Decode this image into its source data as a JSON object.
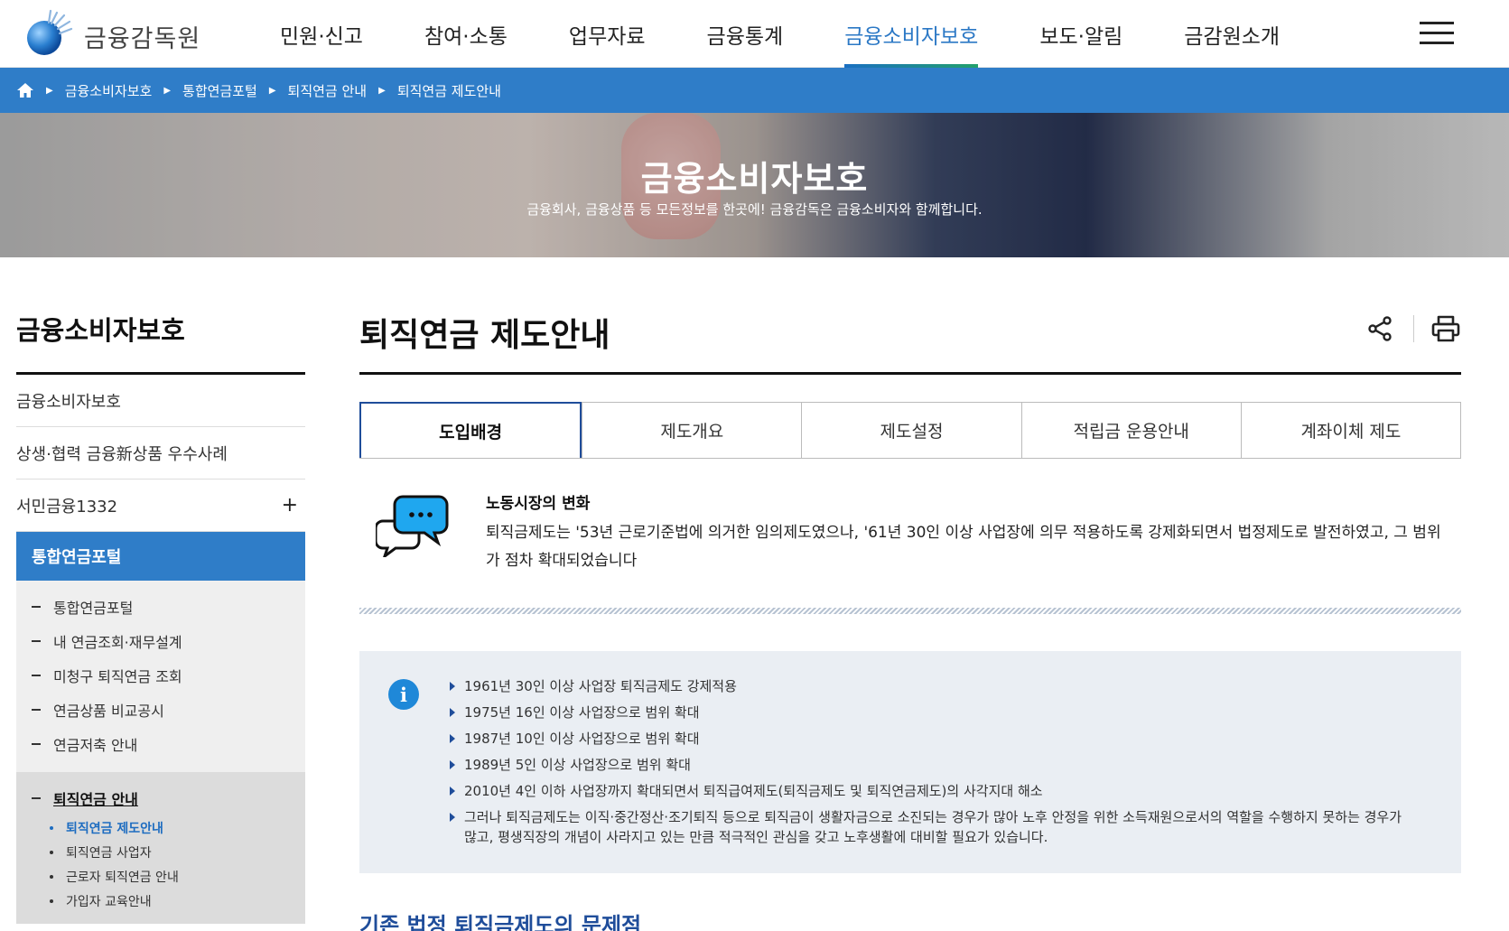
{
  "header": {
    "logo_text": "금융감독원",
    "nav": [
      {
        "label": "민원·신고"
      },
      {
        "label": "참여·소통"
      },
      {
        "label": "업무자료"
      },
      {
        "label": "금융통계"
      },
      {
        "label": "금융소비자보호"
      },
      {
        "label": "보도·알림"
      },
      {
        "label": "금감원소개"
      }
    ],
    "nav_active_index": 4
  },
  "breadcrumb": [
    "금융소비자보호",
    "통합연금포털",
    "퇴직연금 안내",
    "퇴직연금 제도안내"
  ],
  "banner": {
    "title": "금융소비자보호",
    "subtitle": "금융회사, 금융상품 등 모든정보를 한곳에! 금융감독은 금융소비자와 함께합니다."
  },
  "sidebar": {
    "title": "금융소비자보호",
    "items": [
      {
        "label": "금융소비자보호"
      },
      {
        "label": "상생·협력 금융新상품 우수사례"
      },
      {
        "label": "서민금융1332",
        "expand": "+"
      },
      {
        "label": "통합연금포털"
      }
    ],
    "sub_items": [
      {
        "label": "통합연금포털"
      },
      {
        "label": "내 연금조회·재무설계"
      },
      {
        "label": "미청구 퇴직연금 조회"
      },
      {
        "label": "연금상품 비교공시"
      },
      {
        "label": "연금저축 안내"
      }
    ],
    "current_sub": {
      "label": "퇴직연금 안내"
    },
    "third_items": [
      {
        "label": "퇴직연금 제도안내"
      },
      {
        "label": "퇴직연금 사업자"
      },
      {
        "label": "근로자 퇴직연금 안내"
      },
      {
        "label": "가입자 교육안내"
      }
    ]
  },
  "main": {
    "title": "퇴직연금 제도안내",
    "tabs": [
      {
        "label": "도입배경"
      },
      {
        "label": "제도개요"
      },
      {
        "label": "제도설정"
      },
      {
        "label": "적립금 운용안내"
      },
      {
        "label": "계좌이체 제도"
      }
    ],
    "active_tab": 0,
    "intro": {
      "heading": "노동시장의 변화",
      "text": "퇴직금제도는 '53년 근로기준법에 의거한 임의제도였으나, '61년 30인 이상 사업장에 의무 적용하도록 강제화되면서 법정제도로 발전하였고, 그 범위가 점차 확대되었습니다"
    },
    "info_icon": "i",
    "info_list": [
      "1961년 30인 이상 사업장 퇴직금제도 강제적용",
      "1975년 16인 이상 사업장으로 범위 확대",
      "1987년 10인 이상 사업장으로 범위 확대",
      "1989년 5인 이상 사업장으로 범위 확대",
      "2010년 4인 이하 사업장까지 확대되면서 퇴직급여제도(퇴직금제도 및 퇴직연금제도)의 사각지대 해소",
      "그러나 퇴직금제도는 이직·중간정산·조기퇴직 등으로 퇴직금이 생활자금으로 소진되는 경우가 많아 노후 안정을 위한 소득재원으로서의 역할을 수행하지 못하는 경우가 많고, 평생직장의 개념이 사라지고 있는 만큼 적극적인 관심을 갖고 노후생활에 대비할 필요가 있습니다."
    ],
    "next_section_title": "기존 법정 퇴직금제도의 문제점"
  },
  "colors": {
    "primary": "#2f7dc8",
    "navy": "#1f4d9a",
    "info_bg": "#eaeef3"
  }
}
